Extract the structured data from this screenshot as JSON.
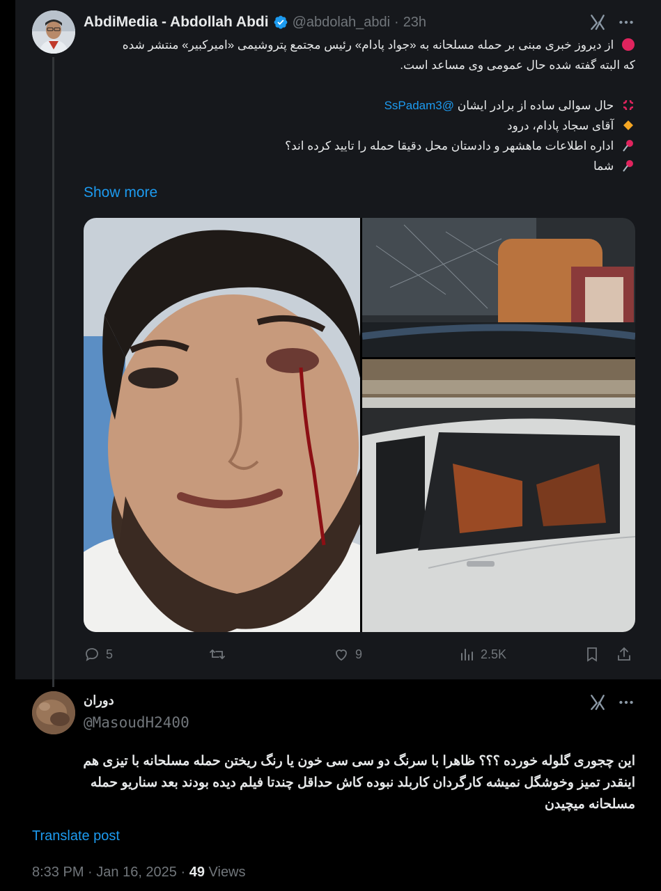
{
  "quoted_post": {
    "display_name": "AbdiMedia - Abdollah Abdi",
    "handle": "@abdolah_abdi",
    "time": "23h",
    "body_lines": [
      "از دیروز خبری مبنی بر حمله مسلحانه به «جواد پادام» رئیس مجتمع پتروشیمی «امیرکبیر» منتشر شده",
      "که البته گفته شده حال عمومی وی مساعد است.",
      "حال سوالی ساده از برادر ایشان",
      "آقای سجاد پادام، درود",
      "اداره اطلاعات ماهشهر و دادستان محل دقیقا حمله را تایید کرده اند؟",
      "شما"
    ],
    "mention": "@SsPadam3",
    "show_more": "Show more",
    "actions": {
      "replies": "5",
      "likes": "9",
      "views": "2.5K"
    }
  },
  "reply_post": {
    "display_name": "دوران",
    "handle": "@MasoudH2400",
    "body_lines": [
      "این چجوری گلوله خورده ؟؟؟ ظاهرا با سرنگ دو سی سی خون یا رنگ ریختن حمله مسلحانه با تیزی هم",
      "اینقدر تمیز وخوشگل نمیشه  کارگردان کاربلد نبوده کاش حداقل چندتا فیلم دیده بودند بعد سناریو حمله",
      "مسلحانه میچیدن"
    ],
    "translate": "Translate post",
    "time": "8:33 PM",
    "date": "Jan 16, 2025",
    "views_count": "49",
    "views_label": "Views"
  },
  "colors": {
    "background": "#000000",
    "card": "#16181c",
    "text": "#e7e9ea",
    "muted": "#71767b",
    "accent": "#1d9bf0"
  },
  "icons": [
    "verified-badge-icon",
    "grok-icon",
    "more-icon",
    "reply-icon",
    "repost-icon",
    "like-icon",
    "views-icon",
    "bookmark-icon",
    "share-icon",
    "red-circle-icon",
    "anger-icon",
    "diamond-icon",
    "pushpin-icon"
  ]
}
